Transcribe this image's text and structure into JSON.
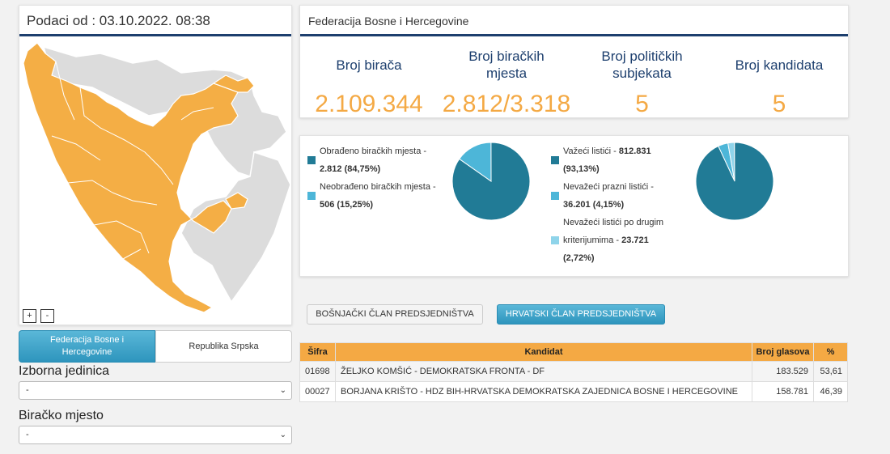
{
  "map_panel": {
    "title": "Podaci od : 03.10.2022. 08:38",
    "zoom_in": "+",
    "zoom_out": "-"
  },
  "entity_tabs": [
    {
      "label": "Federacija Bosne i Hercegovine",
      "active": true
    },
    {
      "label": "Republika Srpska",
      "active": false
    }
  ],
  "filters": {
    "unit_label": "Izborna jedinica",
    "unit_value": "-",
    "station_label": "Biračko mjesto",
    "station_value": "-"
  },
  "stats": {
    "title": "Federacija Bosne i Hercegovine",
    "items": [
      {
        "label": "Broj birača",
        "value": "2.109.344"
      },
      {
        "label": "Broj biračkih mjesta",
        "value": "2.812/3.318"
      },
      {
        "label": "Broj političkih subjekata",
        "value": "5"
      },
      {
        "label": "Broj kandidata",
        "value": "5"
      }
    ]
  },
  "pie_left": {
    "legend": [
      {
        "text": "Obrađeno biračkih mjesta -",
        "value": "2.812 (84,75%)",
        "color": "#217b96",
        "fraction": 0.8475
      },
      {
        "text": "Neobrađeno biračkih mjesta -",
        "value": "506 (15,25%)",
        "color": "#4db6d8",
        "fraction": 0.1525
      }
    ]
  },
  "pie_right": {
    "legend": [
      {
        "text": "Važeći listići -",
        "value": "812.831",
        "pct": "(93,13%)",
        "color": "#217b96",
        "fraction": 0.9313
      },
      {
        "text": "Nevažeći prazni listići -",
        "value": "36.201 (4,15%)",
        "color": "#4db6d8",
        "fraction": 0.0415
      },
      {
        "text": "Nevažeći listići po drugim",
        "text2": "kriterijumima -",
        "value": "23.721",
        "pct": "(2,72%)",
        "color": "#8fd4ea",
        "fraction": 0.0272
      }
    ]
  },
  "candidate_tabs": {
    "bosniak": "BOŠNJAČKI ČLAN PREDSJEDNIŠTVA",
    "croat": "HRVATSKI ČLAN PREDSJEDNIŠTVA"
  },
  "table": {
    "headers": [
      "Šifra",
      "Kandidat",
      "Broj glasova",
      "%"
    ],
    "rows": [
      [
        "01698",
        "ŽELJKO KOMŠIĆ - DEMOKRATSKA FRONTA - DF",
        "183.529",
        "53,61"
      ],
      [
        "00027",
        "BORJANA KRIŠTO - HDZ BIH-HRVATSKA DEMOKRATSKA ZAJEDNICA BOSNE I HERCEGOVINE",
        "158.781",
        "46,39"
      ]
    ]
  },
  "colors": {
    "accent_orange": "#f4a944",
    "navy": "#1d3f6e",
    "teal_dark": "#217b96",
    "teal_light": "#4db6d8",
    "map_grey": "#dcdcdc"
  }
}
